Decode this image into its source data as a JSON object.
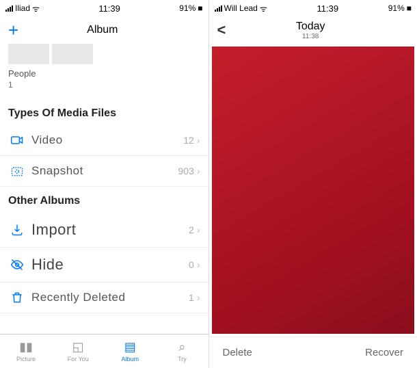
{
  "left": {
    "status": {
      "carrier": "Iliad",
      "time": "11:39",
      "battery": "91%"
    },
    "nav": {
      "title": "Album"
    },
    "people": {
      "label": "People",
      "count": "1"
    },
    "section_media": "Types Of Media Files",
    "media": [
      {
        "label": "Video",
        "count": "12"
      },
      {
        "label": "Snapshot",
        "count": "903"
      }
    ],
    "section_other": "Other Albums",
    "other": [
      {
        "label": "Import",
        "count": "2"
      },
      {
        "label": "Hide",
        "count": "0"
      },
      {
        "label": "Recently Deleted",
        "count": "1"
      }
    ],
    "tabs": [
      {
        "label": "Picture"
      },
      {
        "label": "For You"
      },
      {
        "label": "Album"
      },
      {
        "label": "Try"
      }
    ]
  },
  "right": {
    "status": {
      "carrier": "Will Lead",
      "time": "11:39",
      "battery": "91%"
    },
    "nav": {
      "title": "Today",
      "sub": "11:38"
    },
    "actions": {
      "delete": "Delete",
      "recover": "Recover"
    }
  }
}
